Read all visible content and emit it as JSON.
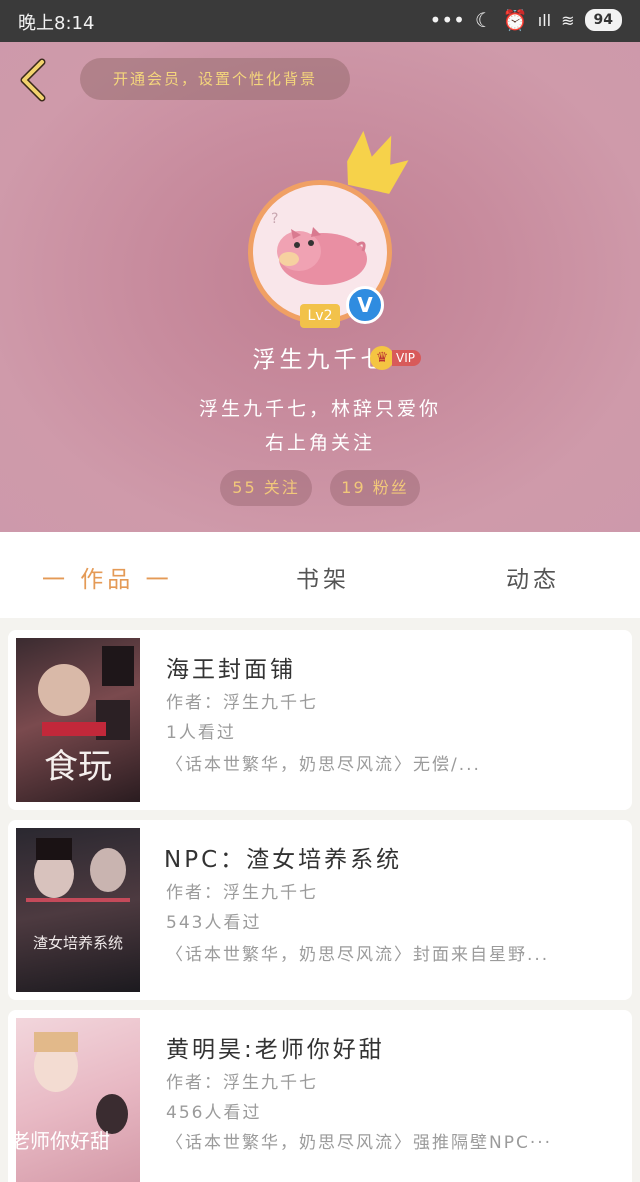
{
  "status_bar": {
    "time": "晚上8:14",
    "battery": "94",
    "icons": [
      "dots-icon",
      "moon-icon",
      "alarm-icon",
      "signal-icon",
      "wifi-icon",
      "battery-icon"
    ]
  },
  "header": {
    "member_banner": "开通会员，设置个性化背景",
    "level": "Lv2",
    "verified_mark": "V",
    "username": "浮生九千七",
    "vip_label": "VIP",
    "bio_line1": "浮生九千七，林辞只爱你",
    "bio_line2": "右上角关注",
    "following": "55 关注",
    "fans": "19 粉丝"
  },
  "tabs": [
    {
      "label": "一 作品 一",
      "active": true
    },
    {
      "label": "书架",
      "active": false
    },
    {
      "label": "动态",
      "active": false
    }
  ],
  "books": [
    {
      "title": "海王封面铺",
      "author": "作者：浮生九千七",
      "views": "1人看过",
      "desc": "〈话本世繁华，奶思尽风流〉无偿/...",
      "cover_text": "食玩"
    },
    {
      "title": "NPC：渣女培养系统",
      "author": "作者：浮生九千七",
      "views": "543人看过",
      "desc": "〈话本世繁华，奶思尽风流〉封面来自星野...",
      "cover_text": "渣女培养系统"
    },
    {
      "title": "黄明昊:老师你好甜",
      "author": "作者：浮生九千七",
      "views": "456人看过",
      "desc": "〈话本世繁华，奶思尽风流〉强推隔壁NPC···",
      "cover_text": "老师你好甜"
    }
  ],
  "colors": {
    "header_bg": "#cd96a6",
    "accent_orange": "#e49a56",
    "gold": "#f4d57c",
    "verified_blue": "#2f8ce0"
  }
}
